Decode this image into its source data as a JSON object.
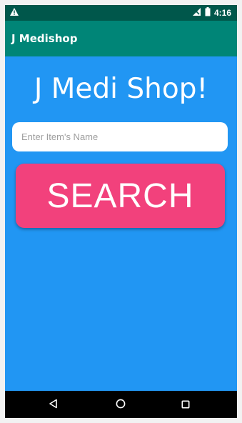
{
  "status_bar": {
    "time": "4:16",
    "icons": [
      "warning-icon",
      "signal-icon",
      "battery-icon"
    ]
  },
  "app_bar": {
    "title": "J Medishop"
  },
  "main": {
    "heading": "J Medi Shop!",
    "search_input": {
      "placeholder": "Enter Item's Name",
      "value": ""
    },
    "search_button_label": "SEARCH"
  },
  "nav_bar": {
    "icons": [
      "back-icon",
      "home-icon",
      "recents-icon"
    ]
  },
  "colors": {
    "status_bar": "#00574b",
    "app_bar": "#008577",
    "background": "#2196F3",
    "accent_button": "#F2417C",
    "nav_bar": "#000000"
  }
}
